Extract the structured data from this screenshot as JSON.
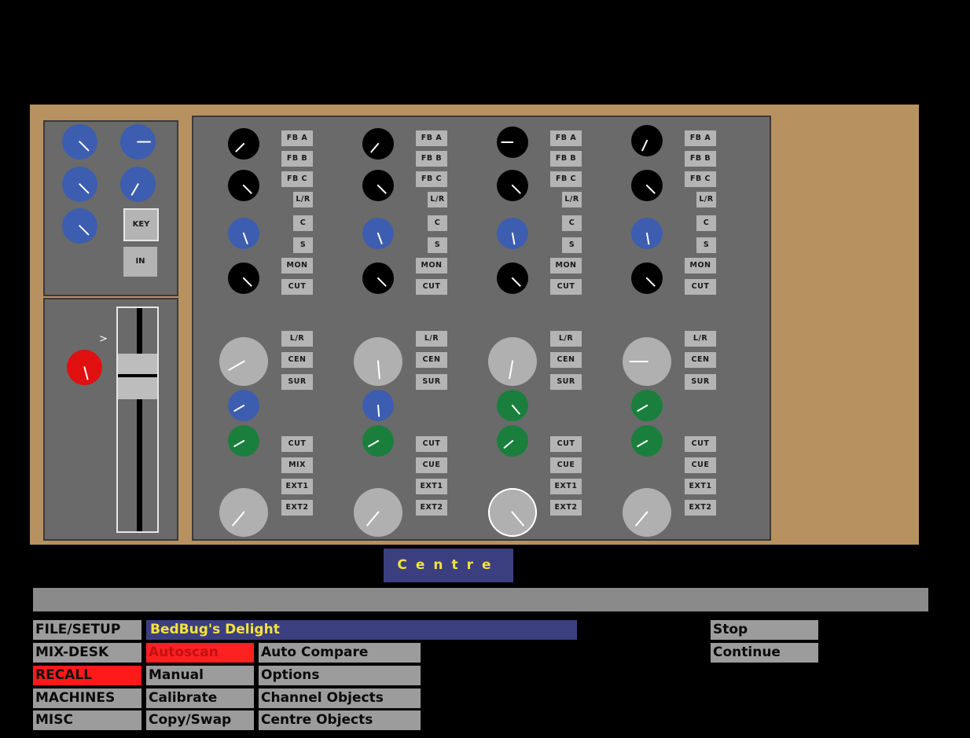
{
  "centre_label": "Centre",
  "title": "BedBug's Delight",
  "left_menu": [
    "FILE/SETUP",
    "MIX-DESK",
    "RECALL",
    "MACHINES",
    "MISC"
  ],
  "left_menu_active": "RECALL",
  "recall_menu": [
    "Autoscan",
    "Manual",
    "Calibrate",
    "Copy/Swap"
  ],
  "recall_menu_active": "Autoscan",
  "options_menu": [
    "Auto Compare",
    "Options",
    "Channel Objects",
    "Centre Objects"
  ],
  "transport": {
    "stop": "Stop",
    "continue": "Continue"
  },
  "aux_panel": {
    "key": "KEY",
    "in": "IN"
  },
  "fader_marker": ">",
  "channel_labels": {
    "fb_a": "FB A",
    "fb_b": "FB B",
    "fb_c": "FB C",
    "lr": "L/R",
    "c": "C",
    "s": "S",
    "mon": "MON",
    "cut": "CUT",
    "pan_lr": "L/R",
    "cen": "CEN",
    "sur": "SUR"
  },
  "channels": [
    {
      "bottom": [
        "CUT",
        "MIX",
        "EXT1",
        "EXT2"
      ]
    },
    {
      "bottom": [
        "CUT",
        "CUE",
        "EXT1",
        "EXT2"
      ]
    },
    {
      "bottom": [
        "CUT",
        "CUE",
        "EXT1",
        "EXT2"
      ]
    },
    {
      "bottom": [
        "CUT",
        "CUE",
        "EXT1",
        "EXT2"
      ]
    }
  ],
  "colors": {
    "frame": "#b89160",
    "panel": "#6a6a6a",
    "blue_knob": "#3d5db0",
    "green_knob": "#1a7f3c",
    "red_knob": "#e01010",
    "grey_knob": "#b0b0b0",
    "black_knob": "#000000",
    "highlight_bg": "#3b3f80",
    "highlight_text": "#f4e23c",
    "active_menu": "#ff1a1a"
  },
  "icons": [
    "rotary-knob-icon",
    "fader-icon"
  ]
}
